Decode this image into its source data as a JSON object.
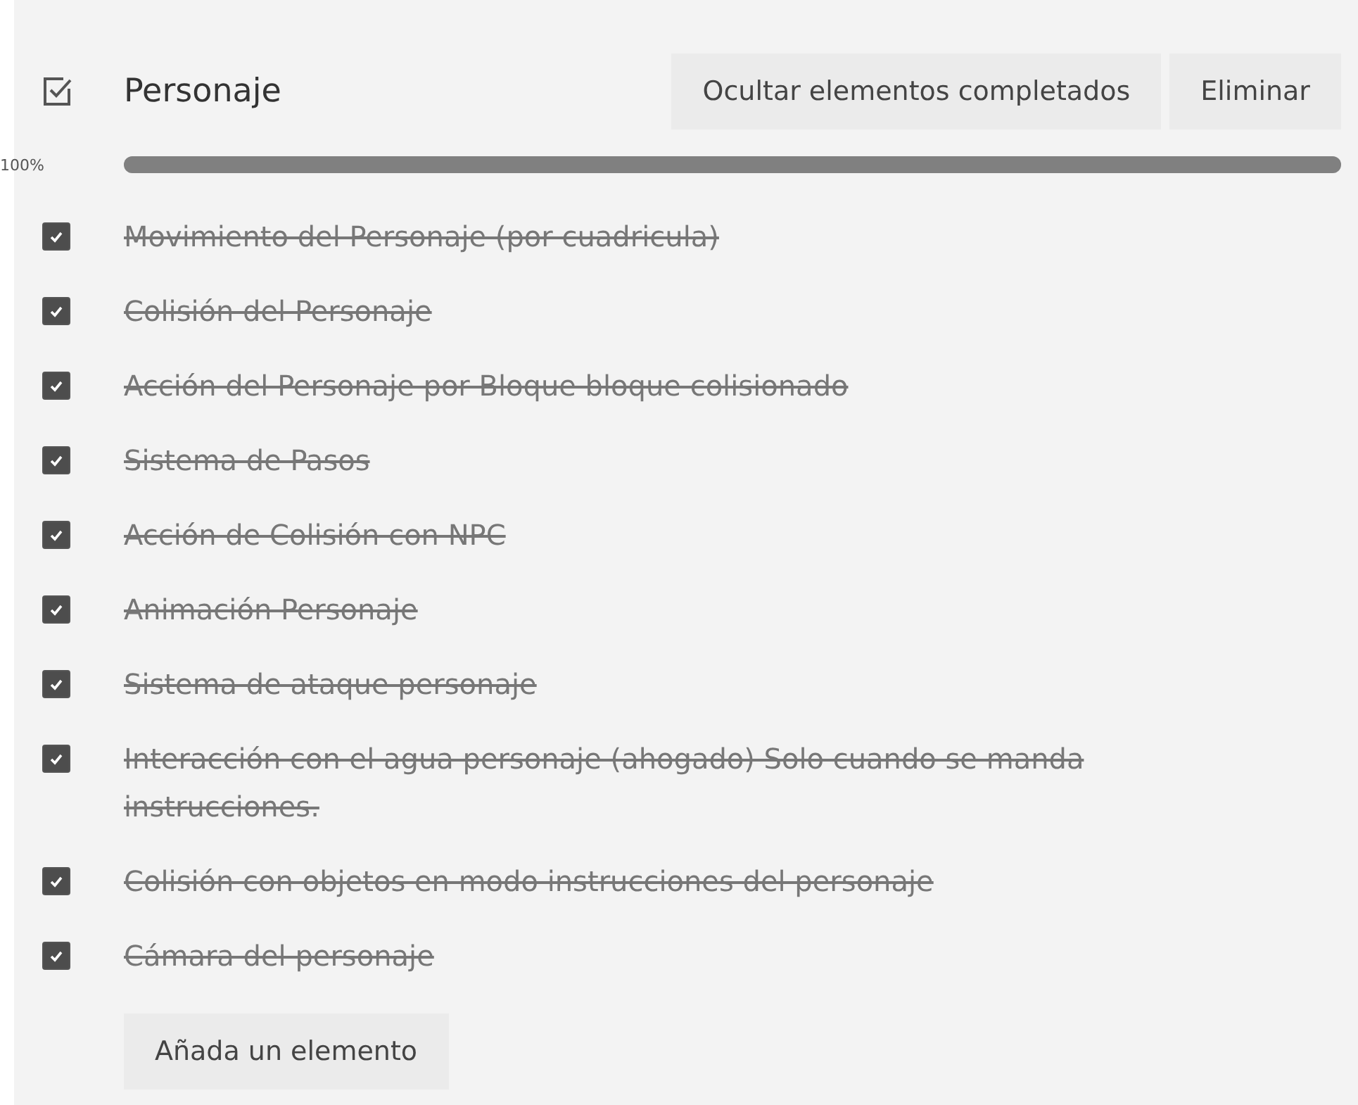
{
  "list": {
    "title": "Personaje",
    "buttons": [
      "Ocultar elementos completados",
      "Eliminar"
    ]
  },
  "progress": {
    "label": "100%",
    "level": 1
  },
  "items": [
    {
      "text": "Movimiento del Personaje (por cuadricula)",
      "checked": true
    },
    {
      "text": "Colisión del Personaje",
      "checked": true
    },
    {
      "text": "Acción del Personaje por Bloque bloque colisionado",
      "checked": true
    },
    {
      "text": "Sistema de Pasos",
      "checked": true
    },
    {
      "text": "Acción de Colisión con NPC",
      "checked": true
    },
    {
      "text": "Animación Personaje",
      "checked": true
    },
    {
      "text": "Sistema de ataque personaje",
      "checked": true
    },
    {
      "text": "Interacción con el agua personaje (ahogado) Solo cuando se manda instrucciones.",
      "checked": true
    },
    {
      "text": "Colisión con objetos en modo instrucciones del personaje",
      "checked": true
    },
    {
      "text": "Cámara del personaje",
      "checked": true
    }
  ],
  "add_button": "Añada un elemento"
}
